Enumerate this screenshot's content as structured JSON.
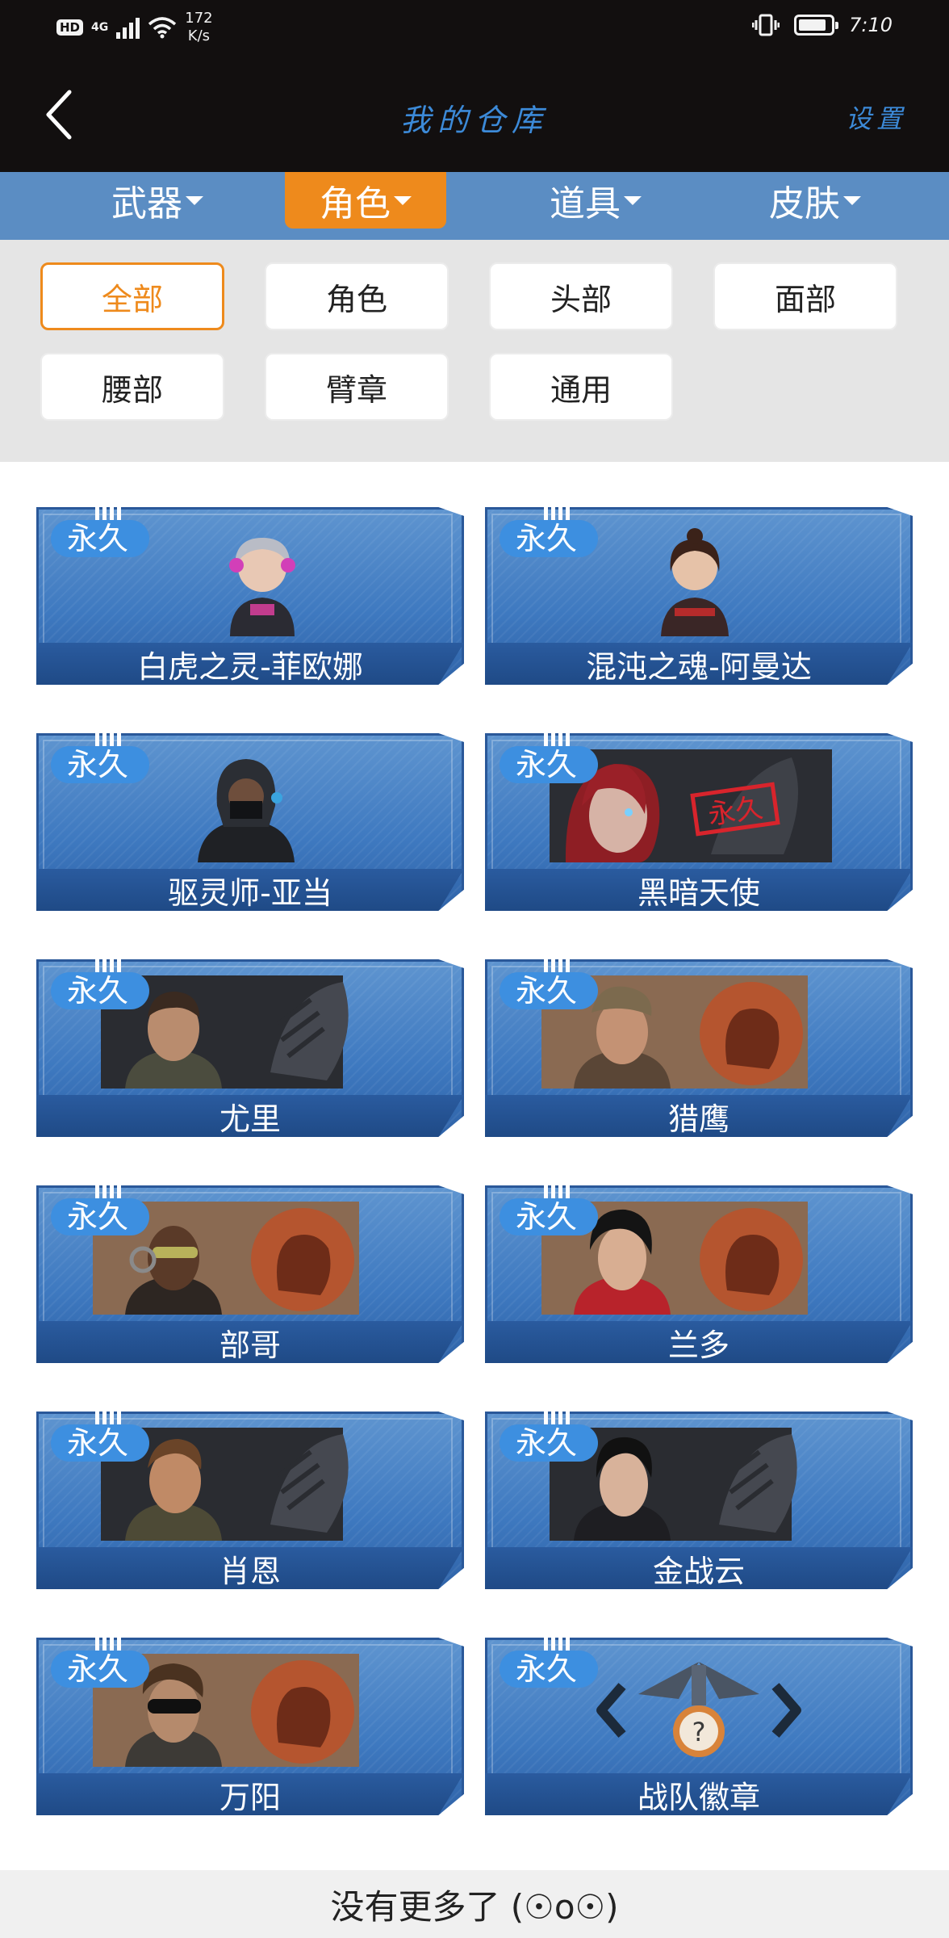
{
  "status_bar": {
    "hd": "HD",
    "network": "4G",
    "speed_value": "172",
    "speed_unit": "K/s",
    "time": "7:10"
  },
  "header": {
    "title": "我的仓库",
    "settings": "设置",
    "back_icon": "chevron-left-icon"
  },
  "category_tabs": [
    {
      "label": "武器",
      "active": false
    },
    {
      "label": "角色",
      "active": true
    },
    {
      "label": "道具",
      "active": false
    },
    {
      "label": "皮肤",
      "active": false
    }
  ],
  "filters": [
    {
      "label": "全部",
      "active": true
    },
    {
      "label": "角色",
      "active": false
    },
    {
      "label": "头部",
      "active": false
    },
    {
      "label": "面部",
      "active": false
    },
    {
      "label": "腰部",
      "active": false
    },
    {
      "label": "臂章",
      "active": false
    },
    {
      "label": "通用",
      "active": false
    }
  ],
  "items": [
    {
      "name": "白虎之灵-菲欧娜",
      "tag": "永久"
    },
    {
      "name": "混沌之魂-阿曼达",
      "tag": "永久"
    },
    {
      "name": "驱灵师-亚当",
      "tag": "永久"
    },
    {
      "name": "黑暗天使",
      "tag": "永久",
      "stamp": "永久"
    },
    {
      "name": "尤里",
      "tag": "永久"
    },
    {
      "name": "猎鹰",
      "tag": "永久"
    },
    {
      "name": "部哥",
      "tag": "永久"
    },
    {
      "name": "兰多",
      "tag": "永久"
    },
    {
      "name": "肖恩",
      "tag": "永久"
    },
    {
      "name": "金战云",
      "tag": "永久"
    },
    {
      "name": "万阳",
      "tag": "永久"
    },
    {
      "name": "战队徽章",
      "tag": "永久",
      "emblem_glyph": "?"
    }
  ],
  "footer": {
    "end_text": "没有更多了 (☉o☉)"
  },
  "colors": {
    "accent_orange": "#ee8a1c",
    "tab_bar_blue": "#5b8dc3",
    "header_text_blue": "#3c8ad8",
    "card_blue": "#3e79c0"
  }
}
